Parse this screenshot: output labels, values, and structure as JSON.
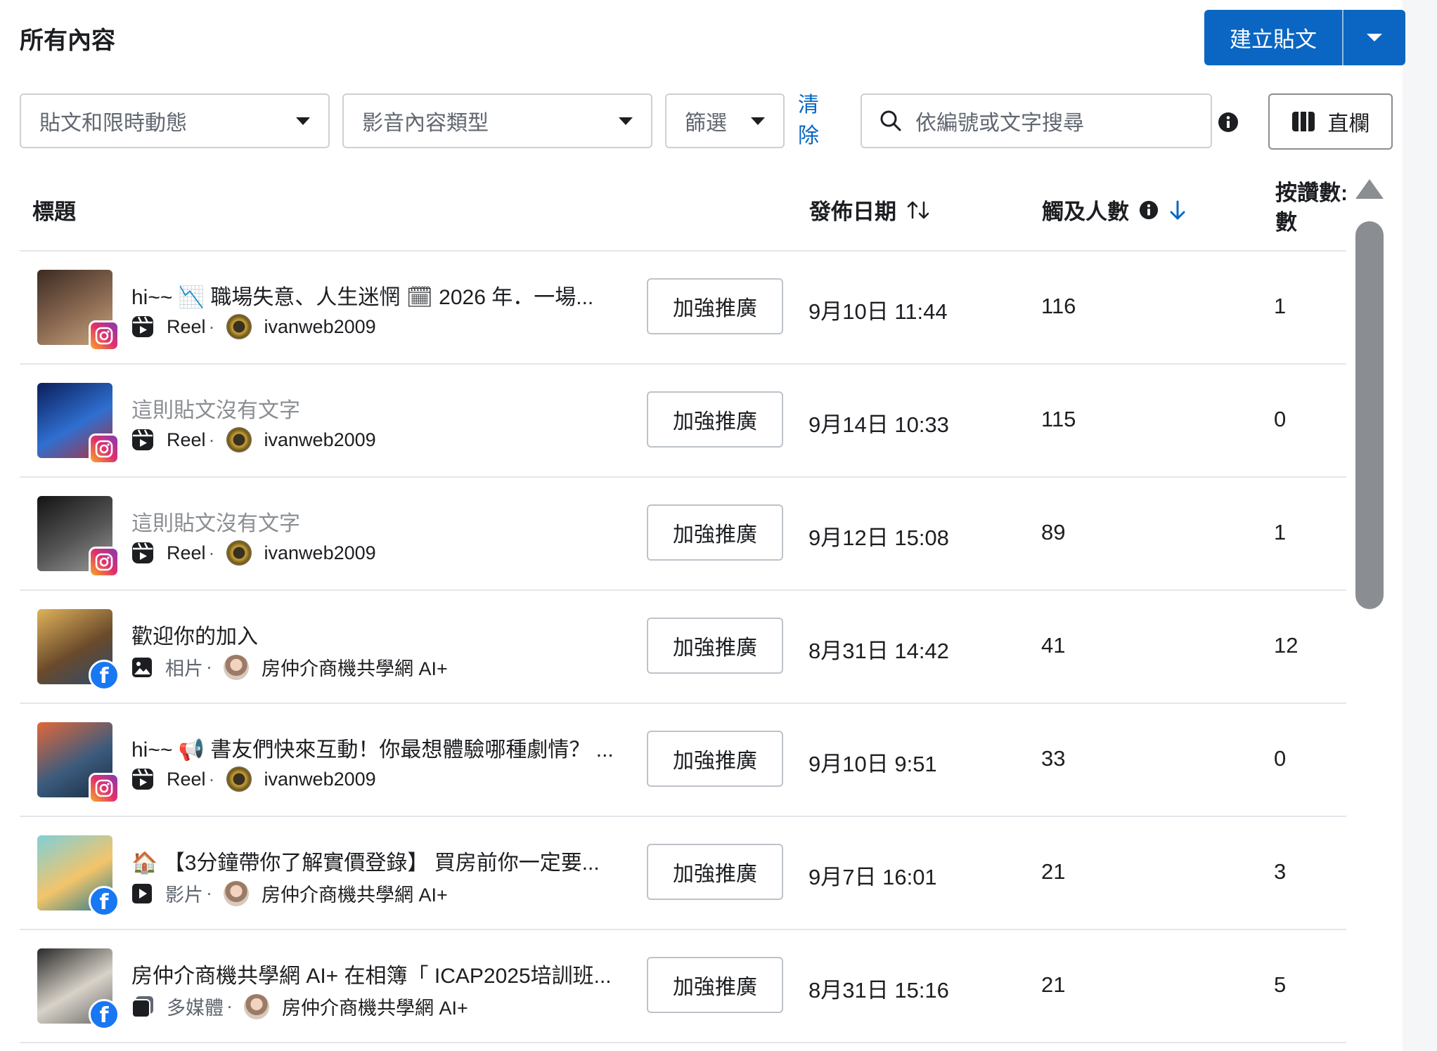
{
  "page_title": "所有內容",
  "create_post": {
    "label": "建立貼文"
  },
  "filters": {
    "post_type": "貼文和限時動態",
    "media_type": "影音內容類型",
    "filter": "篩選",
    "clear_line1": "清",
    "clear_line2": "除",
    "search_placeholder": "依編號或文字搜尋",
    "columns": "直欄"
  },
  "table": {
    "headers": {
      "title": "標題",
      "date": "發佈日期",
      "reach": "觸及人數",
      "likes_line1": "按讚數:",
      "likes_line2": "數"
    },
    "boost_label": "加強推廣",
    "rows": [
      {
        "title": "hi~~ 📉 職場失意、人生迷惘 🗓 2026 年．一場...",
        "title_muted": false,
        "platform": "instagram",
        "post_type": "Reel",
        "separator": "·",
        "account": "ivanweb2009",
        "date": "9月10日 11:44",
        "reach": "116",
        "likes": "1",
        "thumb_colors": [
          "#3b2b22",
          "#8b6a52",
          "#c9a57f"
        ]
      },
      {
        "title": "這則貼文沒有文字",
        "title_muted": true,
        "platform": "instagram",
        "post_type": "Reel",
        "separator": "·",
        "account": "ivanweb2009",
        "date": "9月14日 10:33",
        "reach": "115",
        "likes": "0",
        "thumb_colors": [
          "#0b1e5b",
          "#2f6fd0",
          "#b0303a"
        ]
      },
      {
        "title": "這則貼文沒有文字",
        "title_muted": true,
        "platform": "instagram",
        "post_type": "Reel",
        "separator": "·",
        "account": "ivanweb2009",
        "date": "9月12日 15:08",
        "reach": "89",
        "likes": "1",
        "thumb_colors": [
          "#141414",
          "#555555",
          "#9a9a9a"
        ]
      },
      {
        "title": "歡迎你的加入",
        "title_muted": false,
        "platform": "facebook",
        "post_type": "相片",
        "separator": "·",
        "account": "房仲介商機共學網 AI+",
        "date": "8月31日 14:42",
        "reach": "41",
        "likes": "12",
        "thumb_colors": [
          "#e0b25a",
          "#6a4a2b",
          "#2d4c6e"
        ]
      },
      {
        "title": "hi~~ 📢 書友們快來互動！你最想體驗哪種劇情？ ...",
        "title_muted": false,
        "platform": "instagram",
        "post_type": "Reel",
        "separator": "·",
        "account": "ivanweb2009",
        "date": "9月10日 9:51",
        "reach": "33",
        "likes": "0",
        "thumb_colors": [
          "#e0683a",
          "#3b5b7d",
          "#1a2b40"
        ]
      },
      {
        "title": "🏠 【3分鐘帶你了解實價登錄】 買房前你一定要...",
        "title_muted": false,
        "platform": "facebook",
        "post_type": "影片",
        "separator": "·",
        "account": "房仲介商機共學網 AI+",
        "date": "9月7日 16:01",
        "reach": "21",
        "likes": "3",
        "thumb_colors": [
          "#7fd0d8",
          "#f3c46a",
          "#2c7c8c"
        ]
      },
      {
        "title": "房仲介商機共學網 AI+ 在相簿「 ICAP2025培訓班...",
        "title_muted": false,
        "platform": "facebook",
        "post_type": "多媒體",
        "separator": "·",
        "account": "房仲介商機共學網 AI+",
        "date": "8月31日 15:16",
        "reach": "21",
        "likes": "5",
        "thumb_colors": [
          "#2a2a2a",
          "#d8d2c8",
          "#6a6a6a"
        ]
      }
    ]
  },
  "colors": {
    "primary": "#0a66c2",
    "border": "#ced0d4",
    "divider": "#e4e6eb",
    "scrollbar": "#8a8d91"
  }
}
